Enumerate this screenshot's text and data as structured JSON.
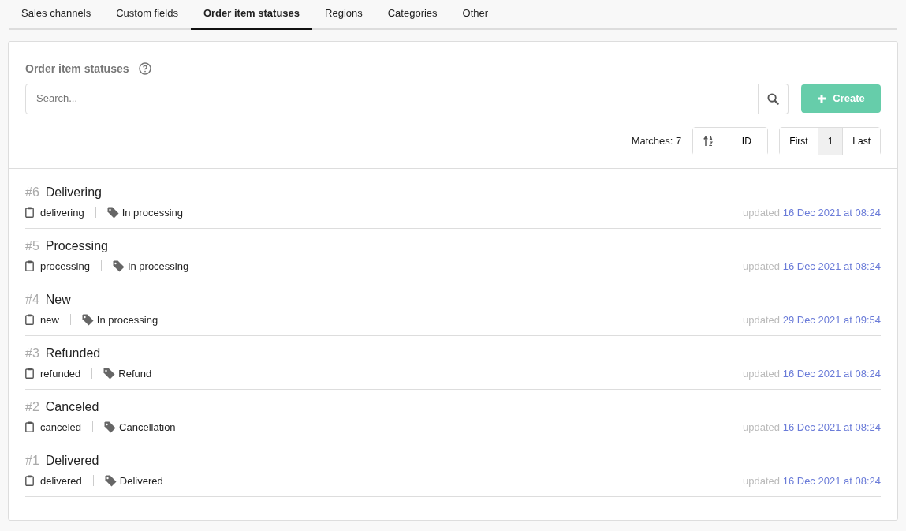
{
  "tabs": [
    {
      "label": "Sales channels",
      "selected": false
    },
    {
      "label": "Custom fields",
      "selected": false
    },
    {
      "label": "Order item statuses",
      "selected": true
    },
    {
      "label": "Regions",
      "selected": false
    },
    {
      "label": "Categories",
      "selected": false
    },
    {
      "label": "Other",
      "selected": false
    }
  ],
  "panel": {
    "title": "Order item statuses",
    "search": {
      "placeholder": "Search..."
    },
    "create_button": "Create",
    "matches": "Matches: 7",
    "sort_field": "ID",
    "pagination": [
      {
        "label": "First",
        "selected": false
      },
      {
        "label": "1",
        "selected": true
      },
      {
        "label": "Last",
        "selected": false
      }
    ]
  },
  "items": [
    {
      "number": "#6",
      "name": "Delivering",
      "code": "delivering",
      "group": "In processing",
      "updated_label": "updated",
      "updated": "16 Dec 2021 at 08:24"
    },
    {
      "number": "#5",
      "name": "Processing",
      "code": "processing",
      "group": "In processing",
      "updated_label": "updated",
      "updated": "16 Dec 2021 at 08:24"
    },
    {
      "number": "#4",
      "name": "New",
      "code": "new",
      "group": "In processing",
      "updated_label": "updated",
      "updated": "29 Dec 2021 at 09:54"
    },
    {
      "number": "#3",
      "name": "Refunded",
      "code": "refunded",
      "group": "Refund",
      "updated_label": "updated",
      "updated": "16 Dec 2021 at 08:24"
    },
    {
      "number": "#2",
      "name": "Canceled",
      "code": "canceled",
      "group": "Cancellation",
      "updated_label": "updated",
      "updated": "16 Dec 2021 at 08:24"
    },
    {
      "number": "#1",
      "name": "Delivered",
      "code": "delivered",
      "group": "Delivered",
      "updated_label": "updated",
      "updated": "16 Dec 2021 at 08:24"
    }
  ]
}
